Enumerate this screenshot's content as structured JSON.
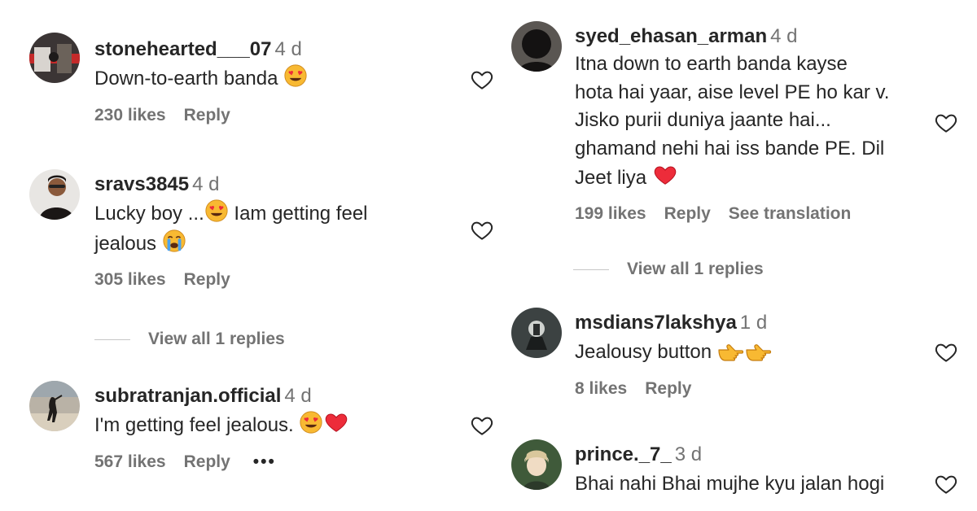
{
  "top_partial_text": "",
  "left_column": [
    {
      "username": "stonehearted___07",
      "time": "4 d",
      "text": "Down-to-earth banda",
      "likes": "230 likes",
      "reply": "Reply"
    },
    {
      "username": "sravs3845",
      "time": "4 d",
      "text_line1": "Lucky boy ...",
      "text_line1b": " Iam getting feel",
      "text_line2": "jealous",
      "likes": "305 likes",
      "reply": "Reply",
      "view_replies": "View all 1 replies"
    },
    {
      "username": "subratranjan.official",
      "time": "4 d",
      "text": "I'm getting feel jealous.",
      "likes": "567 likes",
      "reply": "Reply",
      "more": "•••"
    }
  ],
  "right_column": [
    {
      "username": "syed_ehasan_arman",
      "time": "4 d",
      "lines": [
        "Itna down to earth banda kayse",
        "hota hai yaar, aise level PE ho kar v.",
        "Jisko purii duniya jaante hai...",
        "ghamand nehi hai iss bande PE. Dil",
        "Jeet liya"
      ],
      "likes": "199 likes",
      "reply": "Reply",
      "translate": "See translation",
      "view_replies": "View all 1 replies"
    },
    {
      "username": "msdians7lakshya",
      "time": "1 d",
      "text": "Jealousy button",
      "likes": "8 likes",
      "reply": "Reply"
    },
    {
      "username": "prince._7_",
      "time": "3 d",
      "text": "Bhai nahi Bhai mujhe kyu jalan hogi"
    }
  ],
  "colors": {
    "text": "#262626",
    "muted": "#737373",
    "heart_red": "#ed2c3a",
    "emoji_yellow": "#f8b932"
  }
}
